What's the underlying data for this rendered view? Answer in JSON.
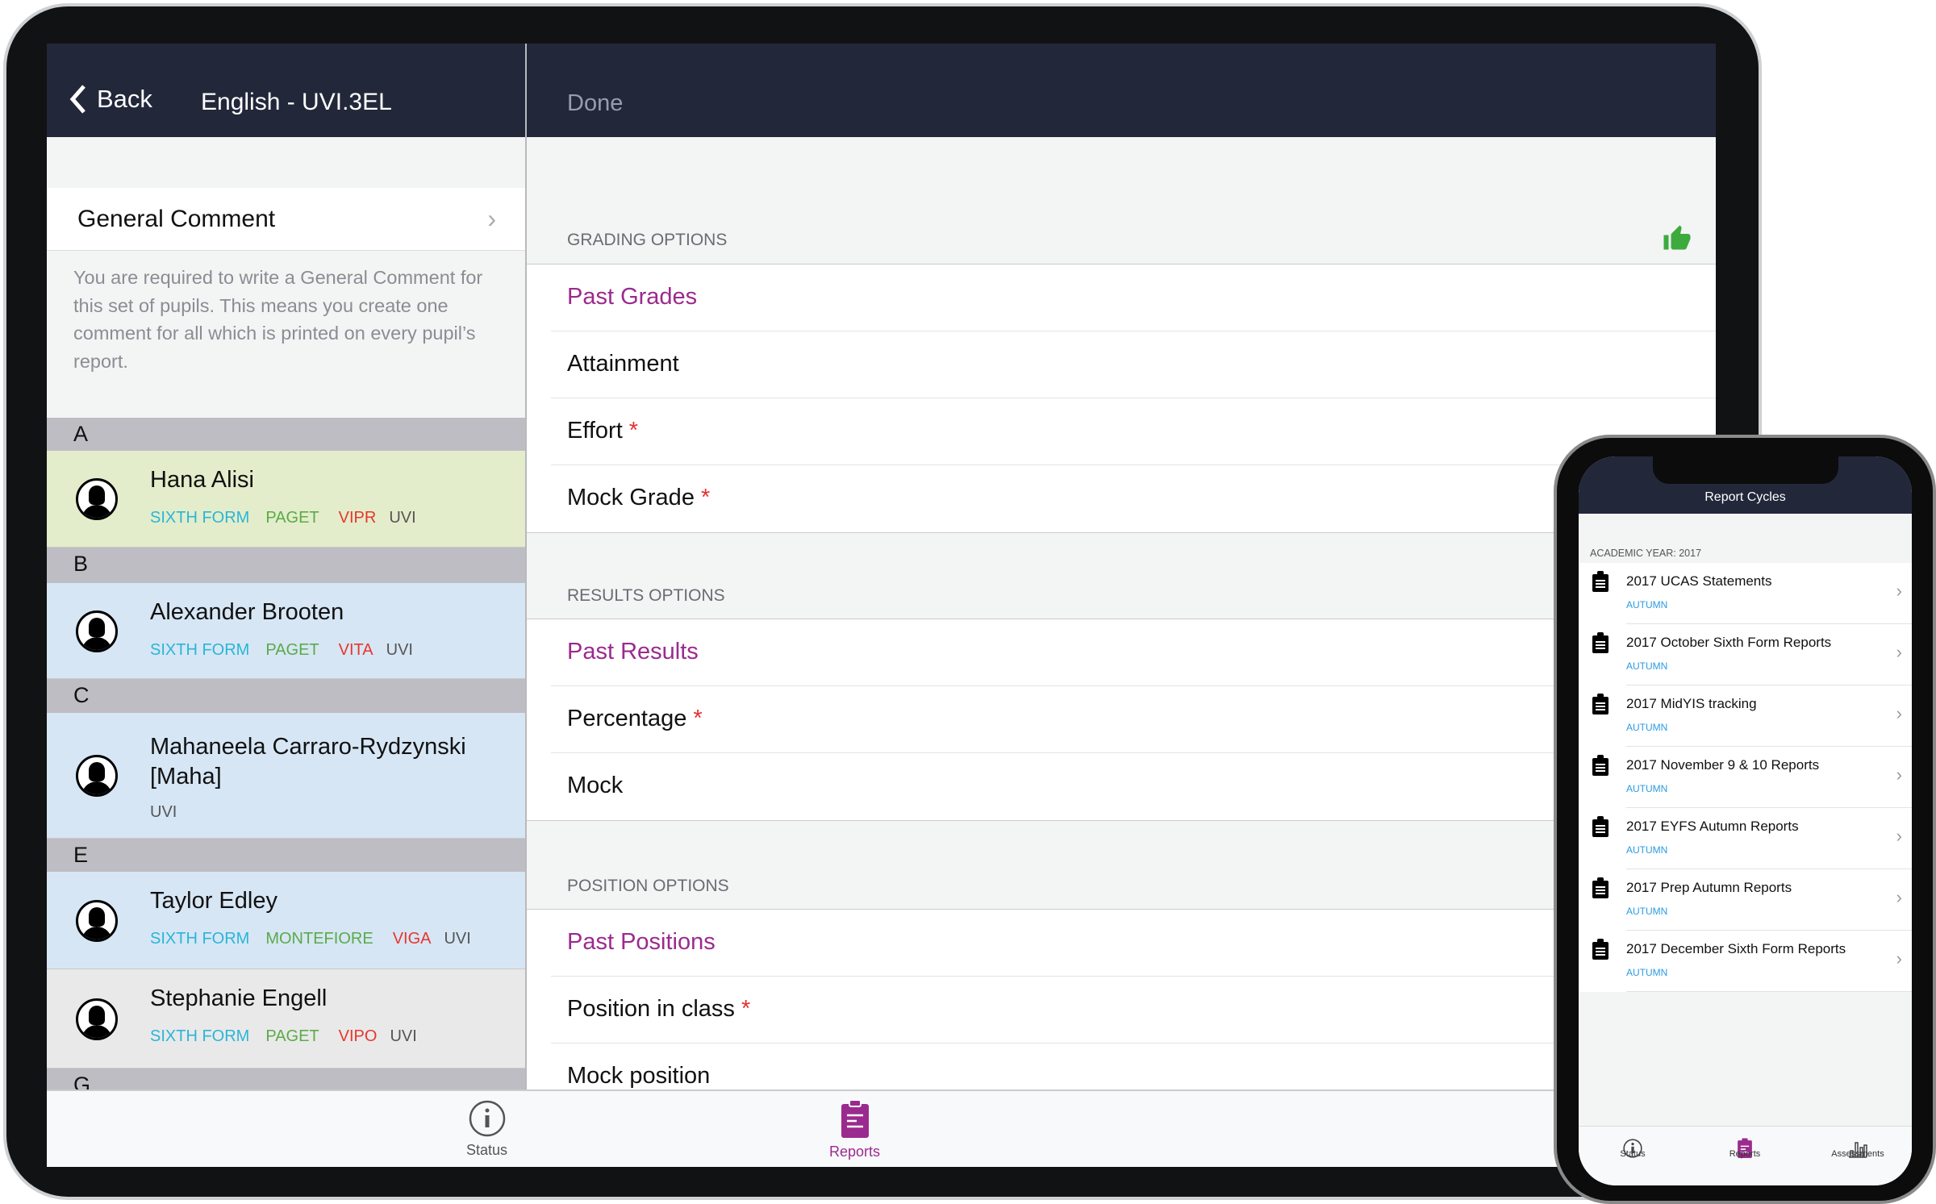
{
  "header": {
    "back_label": "Back",
    "title": "English - UVI.3EL",
    "done_label": "Done"
  },
  "general_comment": {
    "label": "General Comment",
    "description": "You are required to write a General Comment for this set of pupils. This means you create one comment for all which is printed on every pupil’s report."
  },
  "tag_colors": {
    "year": "#2bb5d6",
    "house": "#5aab47",
    "form": "#e8362b",
    "set": "#555555"
  },
  "pupil_list": [
    {
      "section": "A"
    },
    {
      "name": "Hana Alisi",
      "tags": [
        "SIXTH FORM",
        "PAGET",
        "VIPR",
        "UVI"
      ],
      "bg": "#e3edcb"
    },
    {
      "section": "B"
    },
    {
      "name": "Alexander Brooten",
      "tags": [
        "SIXTH FORM",
        "PAGET",
        "VITA",
        "UVI"
      ],
      "bg": "#d6e6f5"
    },
    {
      "section": "C"
    },
    {
      "name": "Mahaneela Carraro-Rydzynski [Maha]",
      "tags": [
        "",
        "",
        "",
        "UVI"
      ],
      "bg": "#d6e6f5"
    },
    {
      "section": "E"
    },
    {
      "name": "Taylor Edley",
      "tags": [
        "SIXTH FORM",
        "MONTEFIORE",
        "VIGA",
        "UVI"
      ],
      "bg": "#d6e6f5"
    },
    {
      "name": "Stephanie Engell",
      "tags": [
        "SIXTH FORM",
        "PAGET",
        "VIPO",
        "UVI"
      ],
      "bg": "#e9e9ea"
    },
    {
      "section": "G"
    }
  ],
  "options": [
    {
      "header": "GRADING OPTIONS",
      "status_icon": "thumbs-up-icon",
      "rows": [
        {
          "label": "Past Grades",
          "past": true
        },
        {
          "label": "Attainment"
        },
        {
          "label": "Effort",
          "required": true
        },
        {
          "label": "Mock Grade",
          "required": true
        }
      ]
    },
    {
      "header": "RESULTS OPTIONS",
      "rows": [
        {
          "label": "Past Results",
          "past": true
        },
        {
          "label": "Percentage",
          "required": true
        },
        {
          "label": "Mock"
        }
      ]
    },
    {
      "header": "POSITION OPTIONS",
      "rows": [
        {
          "label": "Past Positions",
          "past": true
        },
        {
          "label": "Position in class",
          "required": true
        },
        {
          "label": "Mock position"
        }
      ]
    }
  ],
  "tabs": [
    {
      "label": "Status",
      "icon": "info-icon"
    },
    {
      "label": "Reports",
      "icon": "clipboard-icon",
      "active": true
    }
  ],
  "phone": {
    "title": "Report Cycles",
    "year_label": "ACADEMIC YEAR: 2017",
    "cycles": [
      {
        "title": "2017 UCAS Statements",
        "term": "AUTUMN"
      },
      {
        "title": "2017 October Sixth Form Reports",
        "term": "AUTUMN"
      },
      {
        "title": "2017 MidYIS tracking",
        "term": "AUTUMN"
      },
      {
        "title": "2017 November 9 & 10 Reports",
        "term": "AUTUMN"
      },
      {
        "title": "2017 EYFS Autumn Reports",
        "term": "AUTUMN"
      },
      {
        "title": "2017 Prep Autumn Reports",
        "term": "AUTUMN"
      },
      {
        "title": "2017 December Sixth Form Reports",
        "term": "AUTUMN"
      }
    ],
    "tabs": [
      {
        "label": "Status",
        "icon": "info-icon"
      },
      {
        "label": "Reports",
        "icon": "clipboard-icon",
        "active": true
      },
      {
        "label": "Assessments",
        "icon": "bar-chart-icon"
      }
    ]
  },
  "colors": {
    "header": "#22273a",
    "accent": "#9b2a8e",
    "required": "#e53030",
    "thumb": "#3daa3d"
  }
}
